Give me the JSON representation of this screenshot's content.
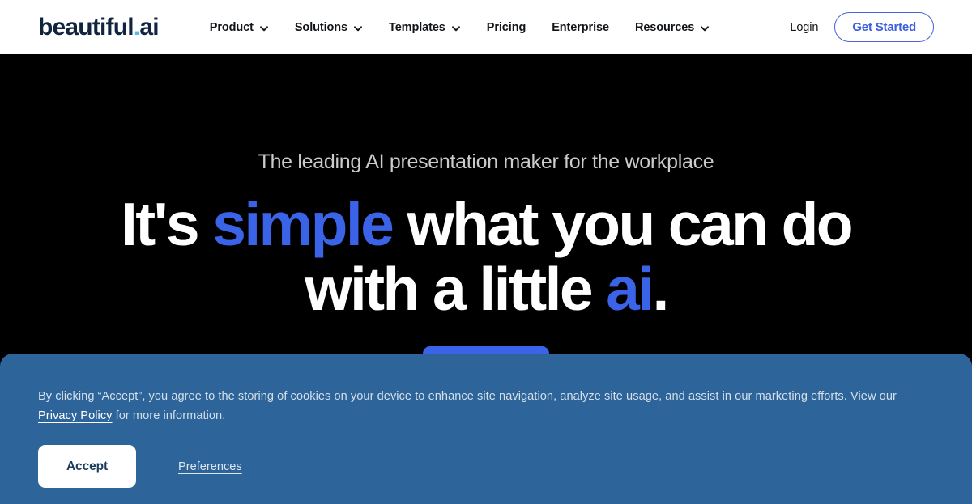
{
  "header": {
    "logo": {
      "name": "beautiful",
      "dot": ".",
      "suffix": "ai"
    },
    "nav": [
      {
        "label": "Product",
        "has_chevron": true,
        "icon": "chevron-down-icon"
      },
      {
        "label": "Solutions",
        "has_chevron": true,
        "icon": "chevron-down-icon"
      },
      {
        "label": "Templates",
        "has_chevron": true,
        "icon": "chevron-down-icon"
      },
      {
        "label": "Pricing",
        "has_chevron": false,
        "icon": ""
      },
      {
        "label": "Enterprise",
        "has_chevron": false,
        "icon": ""
      },
      {
        "label": "Resources",
        "has_chevron": true,
        "icon": "chevron-down-icon"
      }
    ],
    "login_label": "Login",
    "get_started_label": "Get Started"
  },
  "hero": {
    "eyebrow": "The leading AI presentation maker for the workplace",
    "headline": {
      "line1_part1": "It's ",
      "line1_accent": "simple",
      "line1_part2": " what you can do",
      "line2_part1": "with a little ",
      "line2_accent": "ai",
      "line2_part2": "."
    },
    "cta_label": ""
  },
  "cookie": {
    "text_before_link": "By clicking “Accept”, you agree to the storing of cookies on your device to enhance site navigation, analyze site usage, and assist in our marketing efforts. View our ",
    "privacy_link": "Privacy Policy",
    "text_after_link": " for more information.",
    "accept_label": "Accept",
    "preferences_label": "Preferences"
  },
  "colors": {
    "brand_navy": "#10243e",
    "logo_dot_blue": "#5bb8e8",
    "accent_blue": "#3b63e8",
    "hero_background": "#000000",
    "banner_background": "#2d6499",
    "header_background": "#ffffff"
  }
}
